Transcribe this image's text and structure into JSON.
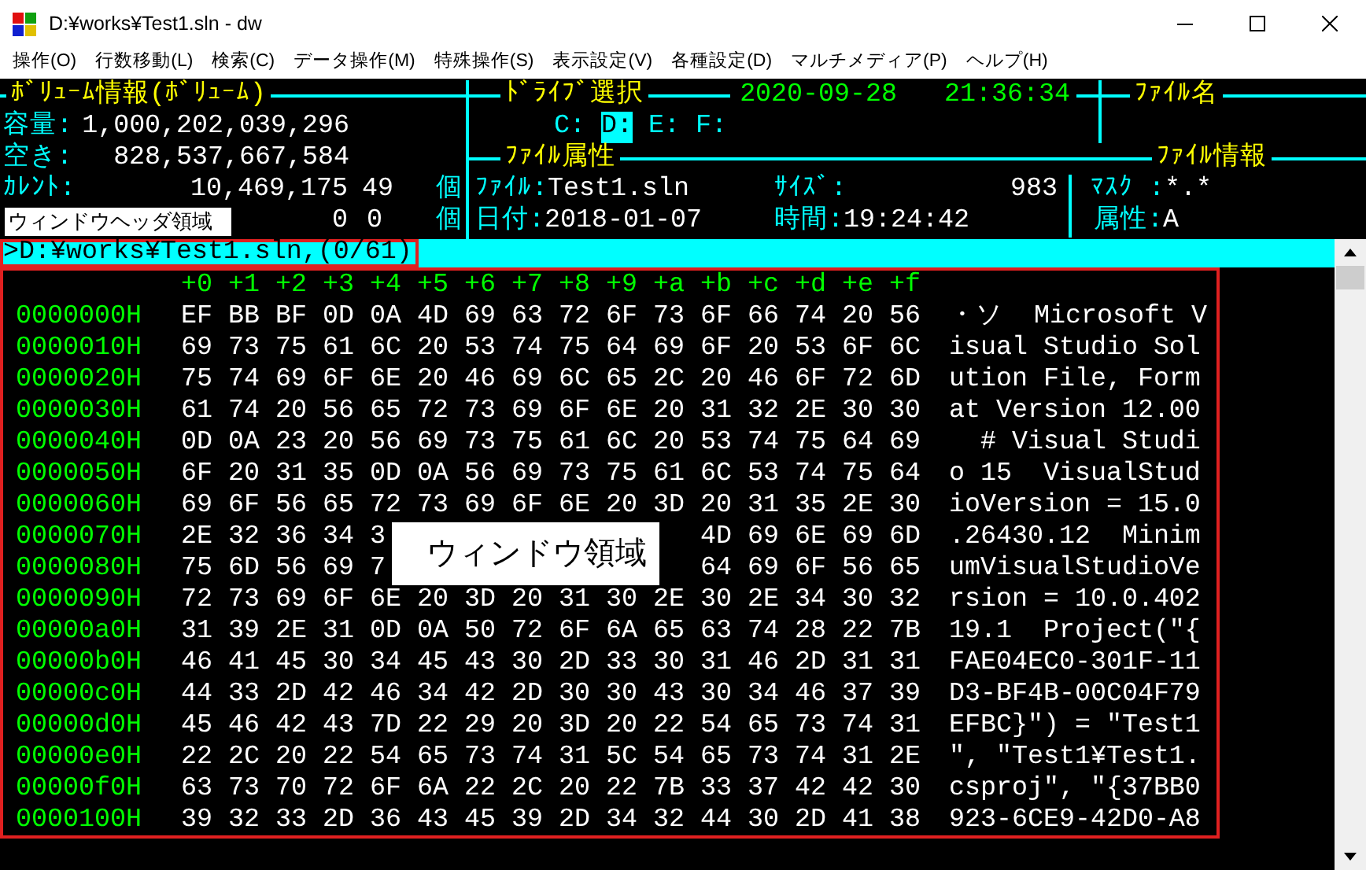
{
  "window": {
    "title": "D:¥works¥Test1.sln - dw"
  },
  "menu": [
    "操作(O)",
    "行数移動(L)",
    "検索(C)",
    "データ操作(M)",
    "特殊操作(S)",
    "表示設定(V)",
    "各種設定(D)",
    "マルチメディア(P)",
    "ヘルプ(H)"
  ],
  "volume_info": {
    "title": "ﾎﾞﾘｭｰﾑ情報(ﾎﾞﾘｭｰﾑ)",
    "rows": [
      {
        "label": "容量:",
        "value": "1,000,202,039,296"
      },
      {
        "label": "空き:",
        "value": "828,537,667,584"
      }
    ],
    "current": {
      "label": "ｶﾚﾝﾄ:",
      "value": "10,469,175",
      "count": "49",
      "unit": "個"
    },
    "header_annotation": "ウィンドウヘッダ領域",
    "second": {
      "value": "0",
      "count": "0",
      "unit": "個"
    }
  },
  "drive_select": {
    "title": "ﾄﾞﾗｲﾌﾞ選択",
    "date": "2020-09-28",
    "time": "21:36:34",
    "drives": [
      {
        "label": "C:",
        "selected": false
      },
      {
        "label": "D:",
        "selected": true
      },
      {
        "label": "E:",
        "selected": false
      },
      {
        "label": "F:",
        "selected": false
      }
    ]
  },
  "file_name": {
    "title": "ﾌｧｲﾙ名"
  },
  "file_attr": {
    "title": "ﾌｧｲﾙ属性",
    "file_label": "ﾌｧｲﾙ:",
    "file": "Test1.sln",
    "size_label": "ｻｲｽﾞ:",
    "size": "983",
    "date_label": "日付:",
    "date": "2018-01-07",
    "time_label": "時間:",
    "time": "19:24:42"
  },
  "file_info": {
    "title": "ﾌｧｲﾙ情報",
    "mask_label": "ﾏｽｸ :",
    "mask": "*.*",
    "attr_label": "属性:",
    "attr": "A"
  },
  "path_bar": {
    "path": ">D:¥works¥Test1.sln,(0/61)"
  },
  "hex": {
    "columns": [
      "+0",
      "+1",
      "+2",
      "+3",
      "+4",
      "+5",
      "+6",
      "+7",
      "+8",
      "+9",
      "+a",
      "+b",
      "+c",
      "+d",
      "+e",
      "+f"
    ],
    "annotation": "ウィンドウ領域",
    "rows": [
      {
        "address": "0000000H",
        "bytes": [
          "EF",
          "BB",
          "BF",
          "0D",
          "0A",
          "4D",
          "69",
          "63",
          "72",
          "6F",
          "73",
          "6F",
          "66",
          "74",
          "20",
          "56"
        ],
        "text": "・ソ  Microsoft V"
      },
      {
        "address": "0000010H",
        "bytes": [
          "69",
          "73",
          "75",
          "61",
          "6C",
          "20",
          "53",
          "74",
          "75",
          "64",
          "69",
          "6F",
          "20",
          "53",
          "6F",
          "6C"
        ],
        "text": "isual Studio Sol"
      },
      {
        "address": "0000020H",
        "bytes": [
          "75",
          "74",
          "69",
          "6F",
          "6E",
          "20",
          "46",
          "69",
          "6C",
          "65",
          "2C",
          "20",
          "46",
          "6F",
          "72",
          "6D"
        ],
        "text": "ution File, Form"
      },
      {
        "address": "0000030H",
        "bytes": [
          "61",
          "74",
          "20",
          "56",
          "65",
          "72",
          "73",
          "69",
          "6F",
          "6E",
          "20",
          "31",
          "32",
          "2E",
          "30",
          "30"
        ],
        "text": "at Version 12.00"
      },
      {
        "address": "0000040H",
        "bytes": [
          "0D",
          "0A",
          "23",
          "20",
          "56",
          "69",
          "73",
          "75",
          "61",
          "6C",
          "20",
          "53",
          "74",
          "75",
          "64",
          "69"
        ],
        "text": "  # Visual Studi"
      },
      {
        "address": "0000050H",
        "bytes": [
          "6F",
          "20",
          "31",
          "35",
          "0D",
          "0A",
          "56",
          "69",
          "73",
          "75",
          "61",
          "6C",
          "53",
          "74",
          "75",
          "64"
        ],
        "text": "o 15  VisualStud"
      },
      {
        "address": "0000060H",
        "bytes": [
          "69",
          "6F",
          "56",
          "65",
          "72",
          "73",
          "69",
          "6F",
          "6E",
          "20",
          "3D",
          "20",
          "31",
          "35",
          "2E",
          "30"
        ],
        "text": "ioVersion = 15.0"
      },
      {
        "address": "0000070H",
        "bytes": [
          "2E",
          "32",
          "36",
          "34",
          "3"
        ],
        "bytes_after": [
          "4D",
          "69",
          "6E",
          "69",
          "6D"
        ],
        "text": ".26430.12  Minim"
      },
      {
        "address": "0000080H",
        "bytes": [
          "75",
          "6D",
          "56",
          "69",
          "7"
        ],
        "bytes_after": [
          "64",
          "69",
          "6F",
          "56",
          "65"
        ],
        "text": "umVisualStudioVe"
      },
      {
        "address": "0000090H",
        "bytes": [
          "72",
          "73",
          "69",
          "6F",
          "6E",
          "20",
          "3D",
          "20",
          "31",
          "30",
          "2E",
          "30",
          "2E",
          "34",
          "30",
          "32"
        ],
        "text": "rsion = 10.0.402"
      },
      {
        "address": "00000a0H",
        "bytes": [
          "31",
          "39",
          "2E",
          "31",
          "0D",
          "0A",
          "50",
          "72",
          "6F",
          "6A",
          "65",
          "63",
          "74",
          "28",
          "22",
          "7B"
        ],
        "text": "19.1  Project(\"{"
      },
      {
        "address": "00000b0H",
        "bytes": [
          "46",
          "41",
          "45",
          "30",
          "34",
          "45",
          "43",
          "30",
          "2D",
          "33",
          "30",
          "31",
          "46",
          "2D",
          "31",
          "31"
        ],
        "text": "FAE04EC0-301F-11"
      },
      {
        "address": "00000c0H",
        "bytes": [
          "44",
          "33",
          "2D",
          "42",
          "46",
          "34",
          "42",
          "2D",
          "30",
          "30",
          "43",
          "30",
          "34",
          "46",
          "37",
          "39"
        ],
        "text": "D3-BF4B-00C04F79"
      },
      {
        "address": "00000d0H",
        "bytes": [
          "45",
          "46",
          "42",
          "43",
          "7D",
          "22",
          "29",
          "20",
          "3D",
          "20",
          "22",
          "54",
          "65",
          "73",
          "74",
          "31"
        ],
        "text": "EFBC}\") = \"Test1"
      },
      {
        "address": "00000e0H",
        "bytes": [
          "22",
          "2C",
          "20",
          "22",
          "54",
          "65",
          "73",
          "74",
          "31",
          "5C",
          "54",
          "65",
          "73",
          "74",
          "31",
          "2E"
        ],
        "text": "\", \"Test1¥Test1."
      },
      {
        "address": "00000f0H",
        "bytes": [
          "63",
          "73",
          "70",
          "72",
          "6F",
          "6A",
          "22",
          "2C",
          "20",
          "22",
          "7B",
          "33",
          "37",
          "42",
          "42",
          "30"
        ],
        "text": "csproj\", \"{37BB0"
      },
      {
        "address": "0000100H",
        "bytes": [
          "39",
          "32",
          "33",
          "2D",
          "36",
          "43",
          "45",
          "39",
          "2D",
          "34",
          "32",
          "44",
          "30",
          "2D",
          "41",
          "38"
        ],
        "text": "923-6CE9-42D0-A8"
      }
    ]
  }
}
